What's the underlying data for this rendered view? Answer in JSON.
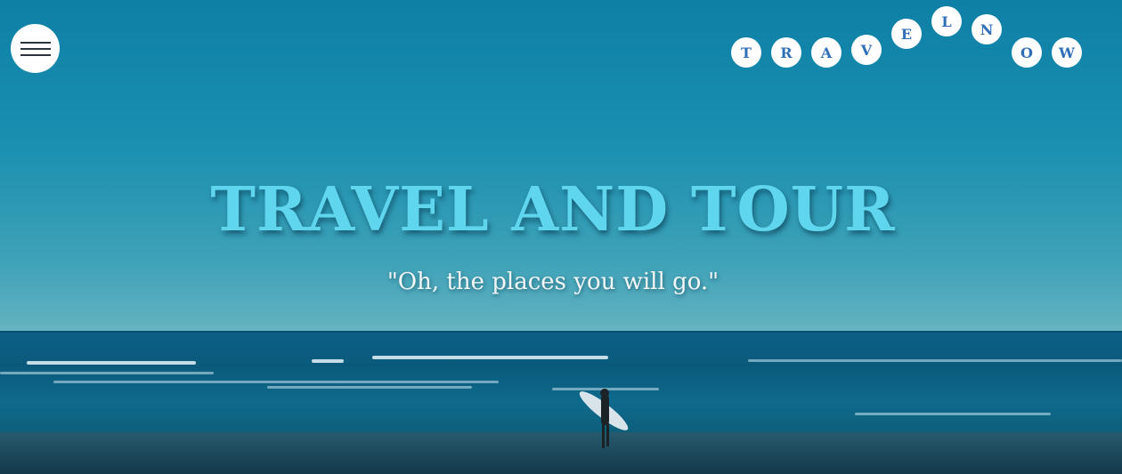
{
  "header": {
    "menu_icon": "hamburger-menu-icon",
    "badge_letters": [
      "T",
      "R",
      "A",
      "V",
      "E",
      "L",
      "N",
      "O",
      "W"
    ]
  },
  "hero": {
    "title": "TRAVEL AND TOUR",
    "subtitle": "\"Oh, the places you will go.\""
  },
  "colors": {
    "title": "#5fd6ee",
    "badge_text": "#2f6fb8",
    "sky": "#1a8fb0",
    "sea": "#0d5f86"
  }
}
